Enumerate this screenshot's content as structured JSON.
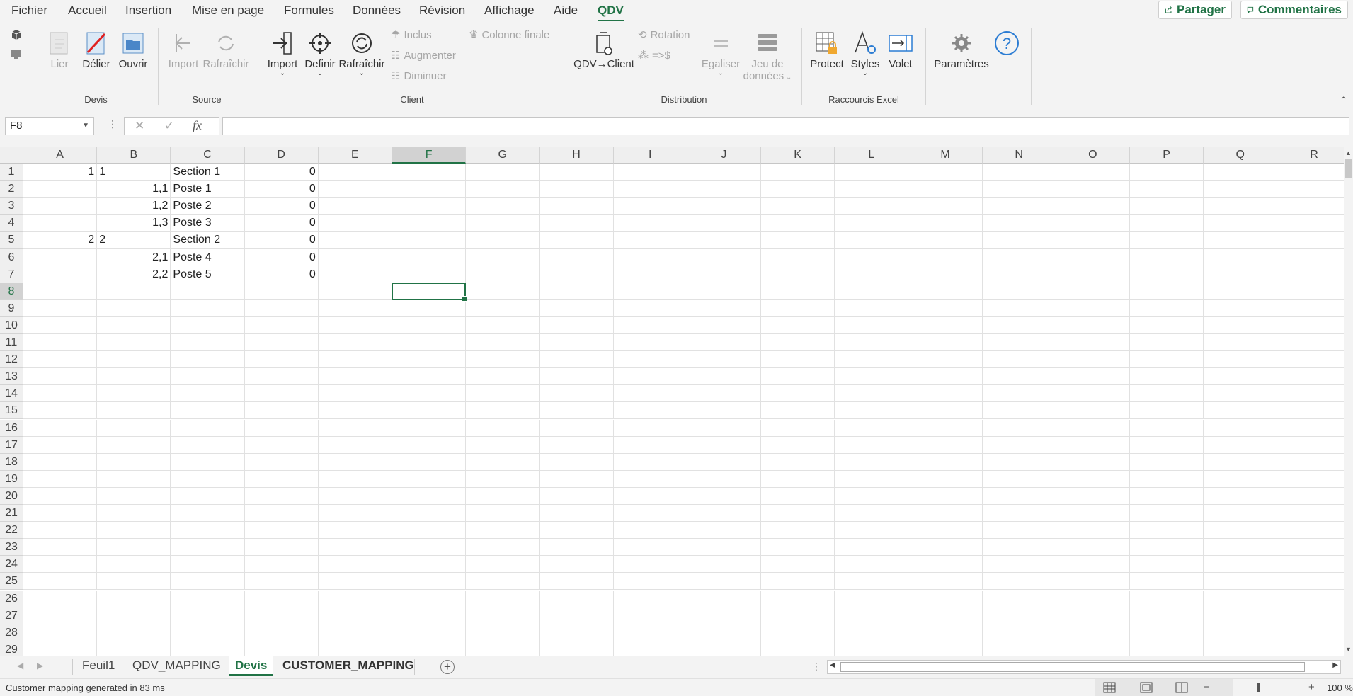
{
  "menu": {
    "tabs": [
      "Fichier",
      "Accueil",
      "Insertion",
      "Mise en page",
      "Formules",
      "Données",
      "Révision",
      "Affichage",
      "Aide",
      "QDV"
    ],
    "active_tab": "QDV",
    "share_label": "Partager",
    "comments_label": "Commentaires"
  },
  "ribbon": {
    "devis": {
      "label": "Devis",
      "lier": "Lier",
      "delier": "Délier",
      "ouvrir": "Ouvrir"
    },
    "source": {
      "label": "Source",
      "import": "Import",
      "rafraichir": "Rafraîchir"
    },
    "client": {
      "label": "Client",
      "import": "Import",
      "definir": "Definir",
      "rafraichir": "Rafraîchir",
      "inclus": "Inclus",
      "augmenter": "Augmenter",
      "diminuer": "Diminuer",
      "colonne_finale": "Colonne finale"
    },
    "distribution": {
      "label": "Distribution",
      "qdv_client": "QDV→Client",
      "rotation": "Rotation",
      "arrow_dollar": "=>$",
      "egaliser": "Egaliser",
      "jeu_de": "Jeu de",
      "donnees": "données"
    },
    "raccourcis": {
      "label": "Raccourcis Excel",
      "protect": "Protect",
      "styles": "Styles",
      "volet": "Volet"
    },
    "parametres": {
      "label": "Paramètres"
    }
  },
  "formula_bar": {
    "name_box": "F8",
    "fx": "fx",
    "formula": ""
  },
  "columns": [
    "A",
    "B",
    "C",
    "D",
    "E",
    "F",
    "G",
    "H",
    "I",
    "J",
    "K",
    "L",
    "M",
    "N",
    "O",
    "P",
    "Q",
    "R"
  ],
  "selected_column": "F",
  "selected_row": "8",
  "rows": [
    "1",
    "2",
    "3",
    "4",
    "5",
    "6",
    "7",
    "8",
    "9",
    "10",
    "11",
    "12",
    "13",
    "14",
    "15",
    "16",
    "17",
    "18",
    "19",
    "20",
    "21",
    "22",
    "23",
    "24",
    "25",
    "26",
    "27",
    "28",
    "29"
  ],
  "cells": [
    {
      "a": "1",
      "b": "1",
      "b_align": "left",
      "c": "Section 1",
      "d": "0"
    },
    {
      "a": "",
      "b": "1,1",
      "b_align": "right",
      "c": "Poste 1",
      "d": "0"
    },
    {
      "a": "",
      "b": "1,2",
      "b_align": "right",
      "c": "Poste 2",
      "d": "0"
    },
    {
      "a": "",
      "b": "1,3",
      "b_align": "right",
      "c": "Poste 3",
      "d": "0"
    },
    {
      "a": "2",
      "b": "2",
      "b_align": "left",
      "c": "Section 2",
      "d": "0"
    },
    {
      "a": "",
      "b": "2,1",
      "b_align": "right",
      "c": "Poste 4",
      "d": "0"
    },
    {
      "a": "",
      "b": "2,2",
      "b_align": "right",
      "c": "Poste 5",
      "d": "0"
    }
  ],
  "sheets": [
    "Feuil1",
    "QDV_MAPPING",
    "Devis",
    "CUSTOMER_MAPPING"
  ],
  "active_sheet": "Devis",
  "status": {
    "message": "Customer mapping generated in 83 ms",
    "zoom": "100 %"
  },
  "colors": {
    "accent": "#217346",
    "ribbon_bg": "#f3f3f3",
    "help_blue": "#2b7cd3"
  }
}
